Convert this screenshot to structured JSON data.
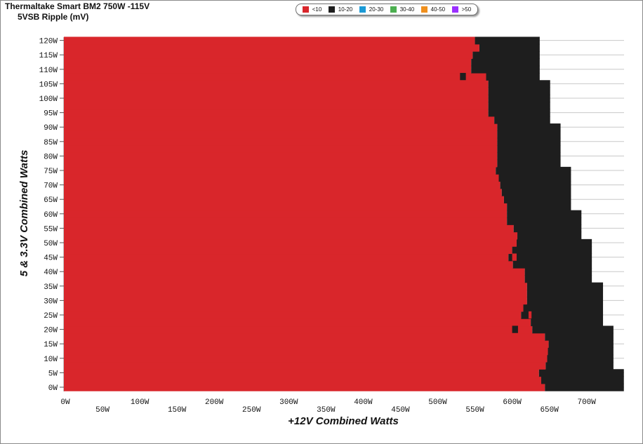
{
  "header": {
    "title": "Thermaltake  Smart BM2 750W -115V",
    "subtitle": "5VSB Ripple (mV)"
  },
  "legend": [
    {
      "label": "<10",
      "color": "#d9262b"
    },
    {
      "label": "10-20",
      "color": "#1e1e1e"
    },
    {
      "label": "20-30",
      "color": "#1b9ad6"
    },
    {
      "label": "30-40",
      "color": "#4caf50"
    },
    {
      "label": "40-50",
      "color": "#f0901e"
    },
    {
      "label": ">50",
      "color": "#9b30ff"
    }
  ],
  "chart_data": {
    "type": "heatmap",
    "xlabel": "+12V Combined Watts",
    "ylabel": "5 & 3.3V Combined Watts",
    "xlim": [
      0,
      750
    ],
    "ylim": [
      0,
      120
    ],
    "x_ticks": [
      "0W",
      "50W",
      "100W",
      "150W",
      "200W",
      "250W",
      "300W",
      "350W",
      "400W",
      "450W",
      "500W",
      "550W",
      "600W",
      "650W",
      "700W"
    ],
    "x_tick_values": [
      0,
      50,
      100,
      150,
      200,
      250,
      300,
      350,
      400,
      450,
      500,
      550,
      600,
      650,
      700
    ],
    "y_ticks": [
      "0W",
      "5W",
      "10W",
      "15W",
      "20W",
      "25W",
      "30W",
      "35W",
      "40W",
      "45W",
      "50W",
      "55W",
      "60W",
      "65W",
      "70W",
      "75W",
      "80W",
      "85W",
      "90W",
      "95W",
      "100W",
      "105W",
      "110W",
      "115W",
      "120W"
    ],
    "y_tick_values": [
      0,
      5,
      10,
      15,
      20,
      25,
      30,
      35,
      40,
      45,
      50,
      55,
      60,
      65,
      70,
      75,
      80,
      85,
      90,
      95,
      100,
      105,
      110,
      115,
      120
    ],
    "grid": true,
    "cell_size_watts": {
      "x": 5,
      "y": 2.5
    },
    "rows": [
      {
        "y": 0,
        "red_max": 644,
        "black_max": 750
      },
      {
        "y": 2.5,
        "red_max": 639,
        "black_max": 750
      },
      {
        "y": 5,
        "red_max": 636,
        "black_max": 750
      },
      {
        "y": 7.5,
        "red_max": 645,
        "black_max": 736
      },
      {
        "y": 10,
        "red_max": 647,
        "black_max": 736
      },
      {
        "y": 12.5,
        "red_max": 648,
        "black_max": 736
      },
      {
        "y": 15,
        "red_max": 649,
        "black_max": 736
      },
      {
        "y": 17.5,
        "red_max": 644,
        "black_max": 736
      },
      {
        "y": 20,
        "red_max": 627,
        "black_max": 736
      },
      {
        "y": 22.5,
        "red_max": 625,
        "black_max": 722
      },
      {
        "y": 25,
        "red_max": 612,
        "black_max": 722
      },
      {
        "y": 27.5,
        "red_max": 615,
        "black_max": 722
      },
      {
        "y": 30,
        "red_max": 620,
        "black_max": 722
      },
      {
        "y": 32.5,
        "red_max": 620,
        "black_max": 722
      },
      {
        "y": 35,
        "red_max": 620,
        "black_max": 722
      },
      {
        "y": 37.5,
        "red_max": 617,
        "black_max": 707
      },
      {
        "y": 40,
        "red_max": 617,
        "black_max": 707
      },
      {
        "y": 42.5,
        "red_max": 601,
        "black_max": 707
      },
      {
        "y": 45,
        "red_max": 595,
        "black_max": 707
      },
      {
        "y": 47.5,
        "red_max": 600,
        "black_max": 707
      },
      {
        "y": 50,
        "red_max": 606,
        "black_max": 707
      },
      {
        "y": 52.5,
        "red_max": 607,
        "black_max": 693
      },
      {
        "y": 55,
        "red_max": 602,
        "black_max": 693
      },
      {
        "y": 57.5,
        "red_max": 593,
        "black_max": 693
      },
      {
        "y": 60,
        "red_max": 593,
        "black_max": 693
      },
      {
        "y": 62.5,
        "red_max": 593,
        "black_max": 679
      },
      {
        "y": 65,
        "red_max": 589,
        "black_max": 679
      },
      {
        "y": 67.5,
        "red_max": 586,
        "black_max": 679
      },
      {
        "y": 70,
        "red_max": 584,
        "black_max": 679
      },
      {
        "y": 72.5,
        "red_max": 582,
        "black_max": 679
      },
      {
        "y": 75,
        "red_max": 578,
        "black_max": 679
      },
      {
        "y": 77.5,
        "red_max": 580,
        "black_max": 665
      },
      {
        "y": 80,
        "red_max": 580,
        "black_max": 665
      },
      {
        "y": 82.5,
        "red_max": 580,
        "black_max": 665
      },
      {
        "y": 85,
        "red_max": 580,
        "black_max": 665
      },
      {
        "y": 87.5,
        "red_max": 580,
        "black_max": 665
      },
      {
        "y": 90,
        "red_max": 580,
        "black_max": 665
      },
      {
        "y": 92.5,
        "red_max": 576,
        "black_max": 651
      },
      {
        "y": 95,
        "red_max": 568,
        "black_max": 651
      },
      {
        "y": 97.5,
        "red_max": 568,
        "black_max": 651
      },
      {
        "y": 100,
        "red_max": 568,
        "black_max": 651
      },
      {
        "y": 102.5,
        "red_max": 568,
        "black_max": 651
      },
      {
        "y": 105,
        "red_max": 568,
        "black_max": 651
      },
      {
        "y": 107.5,
        "red_max": 565,
        "black_max": 637
      },
      {
        "y": 110,
        "red_max": 545,
        "black_max": 637
      },
      {
        "y": 112.5,
        "red_max": 545,
        "black_max": 637
      },
      {
        "y": 115,
        "red_max": 547,
        "black_max": 637
      },
      {
        "y": 117.5,
        "red_max": 556,
        "black_max": 637
      },
      {
        "y": 120,
        "red_max": 550,
        "black_max": 637
      }
    ],
    "isolated_cells": [
      {
        "x": 530,
        "y": 107.5,
        "value": "10-20"
      },
      {
        "x": 600,
        "y": 20,
        "value": "10-20"
      }
    ],
    "pockets": [
      {
        "x_start": 600,
        "x_end": 606,
        "y": 45,
        "value": "<10"
      },
      {
        "x_start": 610,
        "x_end": 615,
        "y": 30,
        "value": "<10"
      },
      {
        "x_start": 622,
        "x_end": 626,
        "y": 25,
        "value": "<10"
      }
    ]
  }
}
